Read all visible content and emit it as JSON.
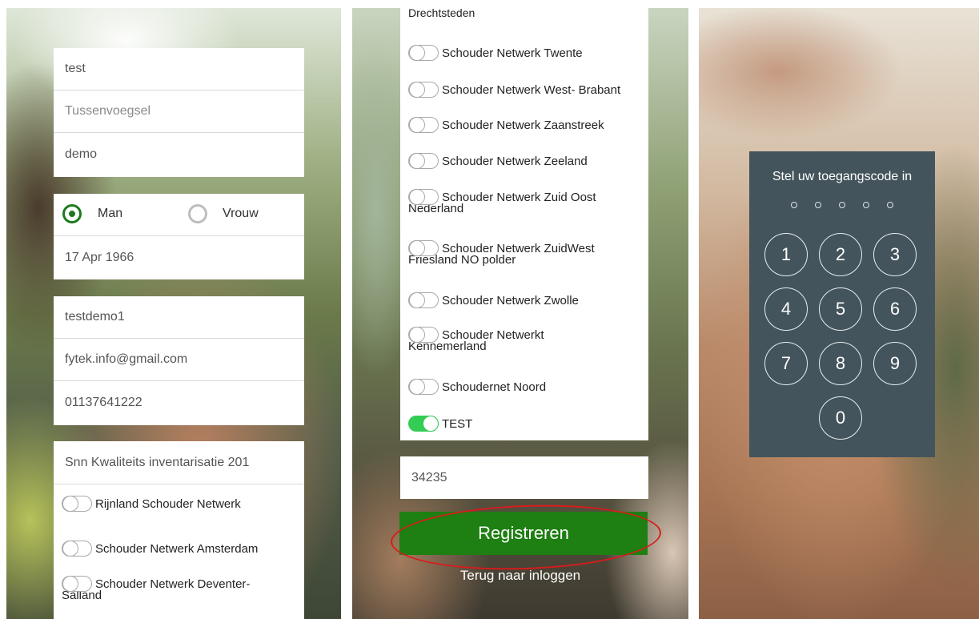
{
  "panel1": {
    "name_fields": [
      "test",
      "Tussenvoegsel",
      "demo"
    ],
    "gender": {
      "options": [
        "Man",
        "Vrouw"
      ],
      "selected": "Man"
    },
    "birthdate": "17 Apr 1966",
    "account_fields": [
      "testdemo1",
      "fytek.info@gmail.com",
      "01137641222"
    ],
    "survey": "Snn Kwaliteits inventarisatie 201",
    "networks": [
      {
        "label": "Rijnland Schouder Netwerk"
      },
      {
        "label": "Schouder Netwerk Amsterdam"
      },
      {
        "label_line1": "Schouder Netwerk Deventer-",
        "label_line2": "Salland"
      }
    ]
  },
  "panel2": {
    "top_cut_label": "Drechtsteden",
    "networks": [
      {
        "label": "Schouder Netwerk Twente"
      },
      {
        "label": "Schouder Netwerk West- Brabant"
      },
      {
        "label": "Schouder Netwerk Zaanstreek"
      },
      {
        "label": "Schouder Netwerk Zeeland"
      },
      {
        "label_line1": "Schouder Netwerk Zuid Oost",
        "label_line2": "Nederland"
      },
      {
        "label_line1": "Schouder Netwerk ZuidWest",
        "label_line2": "Friesland NO polder"
      },
      {
        "label": "Schouder Netwerk Zwolle"
      },
      {
        "label_line1": "Schouder Netwerkt",
        "label_line2": "Kennemerland"
      },
      {
        "label": "Schoudernet Noord"
      },
      {
        "label": "TEST",
        "on": true
      }
    ],
    "code_value": "34235",
    "register_button": "Registreren",
    "back_link": "Terug naar inloggen",
    "annotation_color": "#d81b1b"
  },
  "panel3": {
    "title": "Stel uw toegangscode in",
    "code_dots": 5,
    "keys": [
      "1",
      "2",
      "3",
      "4",
      "5",
      "6",
      "7",
      "8",
      "9",
      "0"
    ]
  },
  "colors": {
    "primary_green": "#1e7f12",
    "toggle_on": "#33cc55",
    "pin_bg": "#44545c"
  }
}
